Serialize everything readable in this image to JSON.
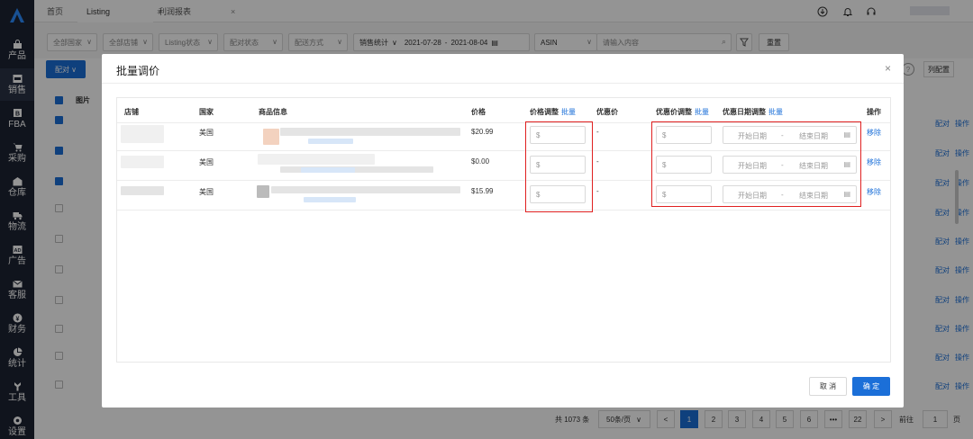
{
  "colors": {
    "primary": "#1b6fd8",
    "sidebar": "#1d2433",
    "highlight": "#e02020"
  },
  "sidebar": {
    "logo_icon": "brand-logo",
    "items": [
      {
        "label": "产品",
        "icon": "bag-icon"
      },
      {
        "label": "销售",
        "icon": "sell-icon"
      },
      {
        "label": "FBA",
        "icon": "box-icon"
      },
      {
        "label": "采购",
        "icon": "cart-icon"
      },
      {
        "label": "仓库",
        "icon": "warehouse-icon"
      },
      {
        "label": "物流",
        "icon": "truck-icon"
      },
      {
        "label": "广告",
        "icon": "ad-icon"
      },
      {
        "label": "客服",
        "icon": "mail-icon"
      },
      {
        "label": "财务",
        "icon": "finance-icon"
      },
      {
        "label": "统计",
        "icon": "pie-icon"
      },
      {
        "label": "工具",
        "icon": "tool-icon"
      },
      {
        "label": "设置",
        "icon": "gear-icon"
      }
    ]
  },
  "tabs": [
    {
      "label": "首页",
      "close": ""
    },
    {
      "label": "Listing",
      "close": "×"
    },
    {
      "label": "利润报表",
      "close": "×"
    }
  ],
  "filters": {
    "country": "全部国家",
    "shop": "全部店铺",
    "listing_status": "Listing状态",
    "pair_status": "配对状态",
    "shipping": "配送方式",
    "metric": "销售统计",
    "date_start": "2021-07-28",
    "date_sep": "-",
    "date_end": "2021-08-04",
    "search_field": "ASIN",
    "search_placeholder": "请输入内容",
    "reset": "重置"
  },
  "background": {
    "pair_button": "配对",
    "col_image": "图片",
    "fifth_label": "列配置",
    "row_op1": "配对",
    "row_op2": "操作",
    "placeholder_img": "无图"
  },
  "pagination": {
    "total": "共 1073 条",
    "page_size": "50条/页",
    "pages": [
      "1",
      "2",
      "3",
      "4",
      "5",
      "6",
      "•••",
      "22"
    ],
    "prev": "<",
    "next": ">",
    "goto_label": "前往",
    "goto_value": "1",
    "page_suffix": "页"
  },
  "modal": {
    "title": "批量调价",
    "close": "×",
    "columns": {
      "shop": "店铺",
      "country": "国家",
      "product_info": "商品信息",
      "price": "价格",
      "price_adjust": "价格调整",
      "discount_price": "优惠价",
      "discount_adjust": "优惠价调整",
      "discount_date_adjust": "优惠日期调整",
      "batch": "批量",
      "action": "操作"
    },
    "rows": [
      {
        "country": "美国",
        "price": "$20.99",
        "price_input": "$",
        "discount_price": "-",
        "discount_input": "$",
        "date_start": "开始日期",
        "date_sep": "-",
        "date_end": "结束日期",
        "action": "移除"
      },
      {
        "country": "美国",
        "price": "$0.00",
        "price_input": "$",
        "discount_price": "-",
        "discount_input": "$",
        "date_start": "开始日期",
        "date_sep": "-",
        "date_end": "结束日期",
        "action": "移除"
      },
      {
        "country": "美国",
        "price": "$15.99",
        "price_input": "$",
        "discount_price": "-",
        "discount_input": "$",
        "date_start": "开始日期",
        "date_sep": "-",
        "date_end": "结束日期",
        "action": "移除"
      }
    ],
    "cancel": "取 消",
    "confirm": "确 定"
  }
}
